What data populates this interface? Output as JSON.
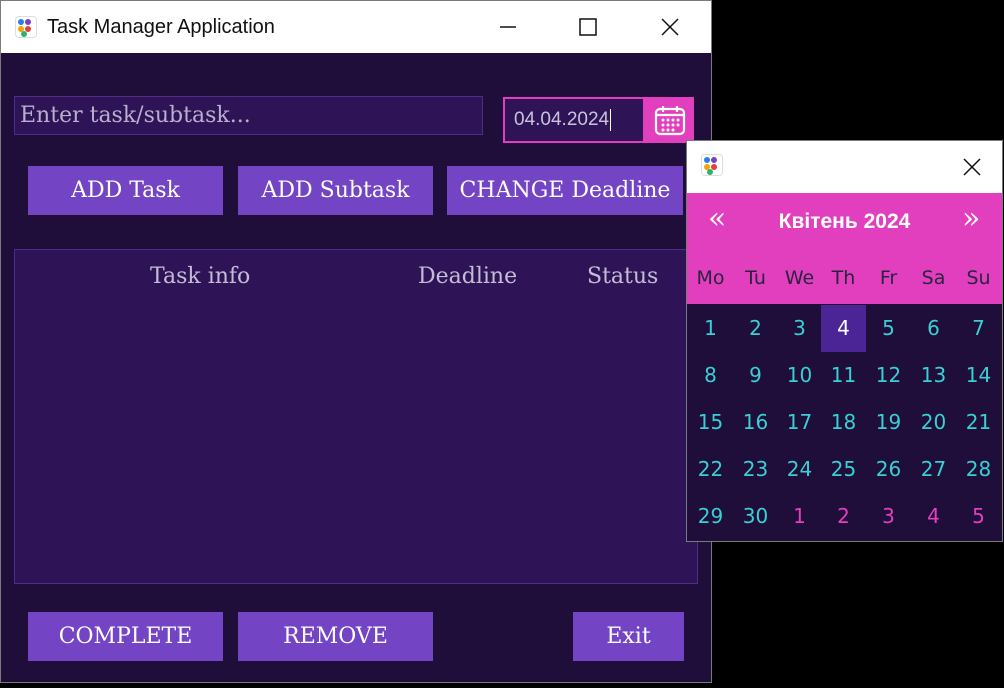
{
  "main_window": {
    "title": "Task Manager Application",
    "task_input": {
      "placeholder": "Enter task/subtask..."
    },
    "date_field": {
      "value": "04.04.2024"
    },
    "buttons": {
      "add_task": "ADD Task",
      "add_subtask": "ADD Subtask",
      "change_deadline": "CHANGE Deadline",
      "complete": "COMPLETE",
      "remove": "REMOVE",
      "exit": "Exit"
    },
    "table": {
      "columns": [
        "Task info",
        "Deadline",
        "Status"
      ],
      "rows": []
    }
  },
  "calendar_popup": {
    "prev_label": "«",
    "next_label": "»",
    "month_label": "Квітень 2024",
    "weekdays": [
      "Mo",
      "Tu",
      "We",
      "Th",
      "Fr",
      "Sa",
      "Su"
    ],
    "weeks": [
      [
        "1",
        "2",
        "3",
        "4",
        "5",
        "6",
        "7"
      ],
      [
        "8",
        "9",
        "10",
        "11",
        "12",
        "13",
        "14"
      ],
      [
        "15",
        "16",
        "17",
        "18",
        "19",
        "20",
        "21"
      ],
      [
        "22",
        "23",
        "24",
        "25",
        "26",
        "27",
        "28"
      ],
      [
        "29",
        "30",
        "1",
        "2",
        "3",
        "4",
        "5"
      ]
    ],
    "selected_day": "4",
    "next_month_days_in_last_week": [
      "1",
      "2",
      "3",
      "4",
      "5"
    ]
  },
  "colors": {
    "window_bg": "#1f0e3a",
    "panel_bg": "#2e1457",
    "button_bg": "#7344c4",
    "accent_pink": "#e23fbf",
    "day_text": "#39d0d4",
    "selected_day_bg": "#4b2596"
  },
  "icons": [
    "app-icon",
    "minimize-icon",
    "maximize-icon",
    "close-icon",
    "calendar-icon"
  ]
}
